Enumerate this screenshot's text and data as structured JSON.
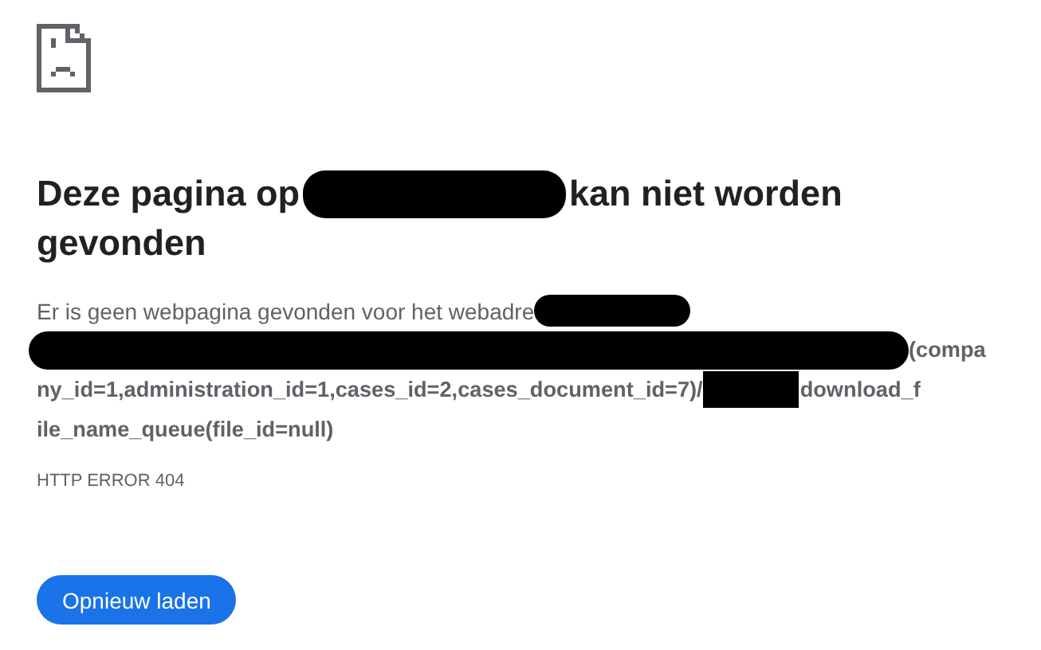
{
  "heading": [
    {
      "kind": "text",
      "text": "Deze pagina op"
    },
    {
      "kind": "redaction"
    },
    {
      "kind": "text",
      "text": "kan niet worden"
    },
    {
      "kind": "break"
    },
    {
      "kind": "text",
      "text": "gevonden"
    }
  ],
  "message": [
    {
      "kind": "text",
      "text": "Er is geen webpagina gevonden voor het webadre"
    },
    {
      "kind": "redaction"
    }
  ],
  "url_lines": [
    [
      {
        "kind": "redaction"
      },
      {
        "kind": "text",
        "text": "(compa"
      }
    ],
    [
      {
        "kind": "text",
        "text": "ny_id=1,administration_id=1,cases_id=2,cases_document_id=7)/"
      },
      {
        "kind": "block"
      },
      {
        "kind": "text",
        "text": "download_f"
      }
    ],
    [
      {
        "kind": "text",
        "text": "ile_name_queue(file_id=null)"
      }
    ]
  ],
  "error_code": "HTTP ERROR 404",
  "reload_button": "Opnieuw laden"
}
